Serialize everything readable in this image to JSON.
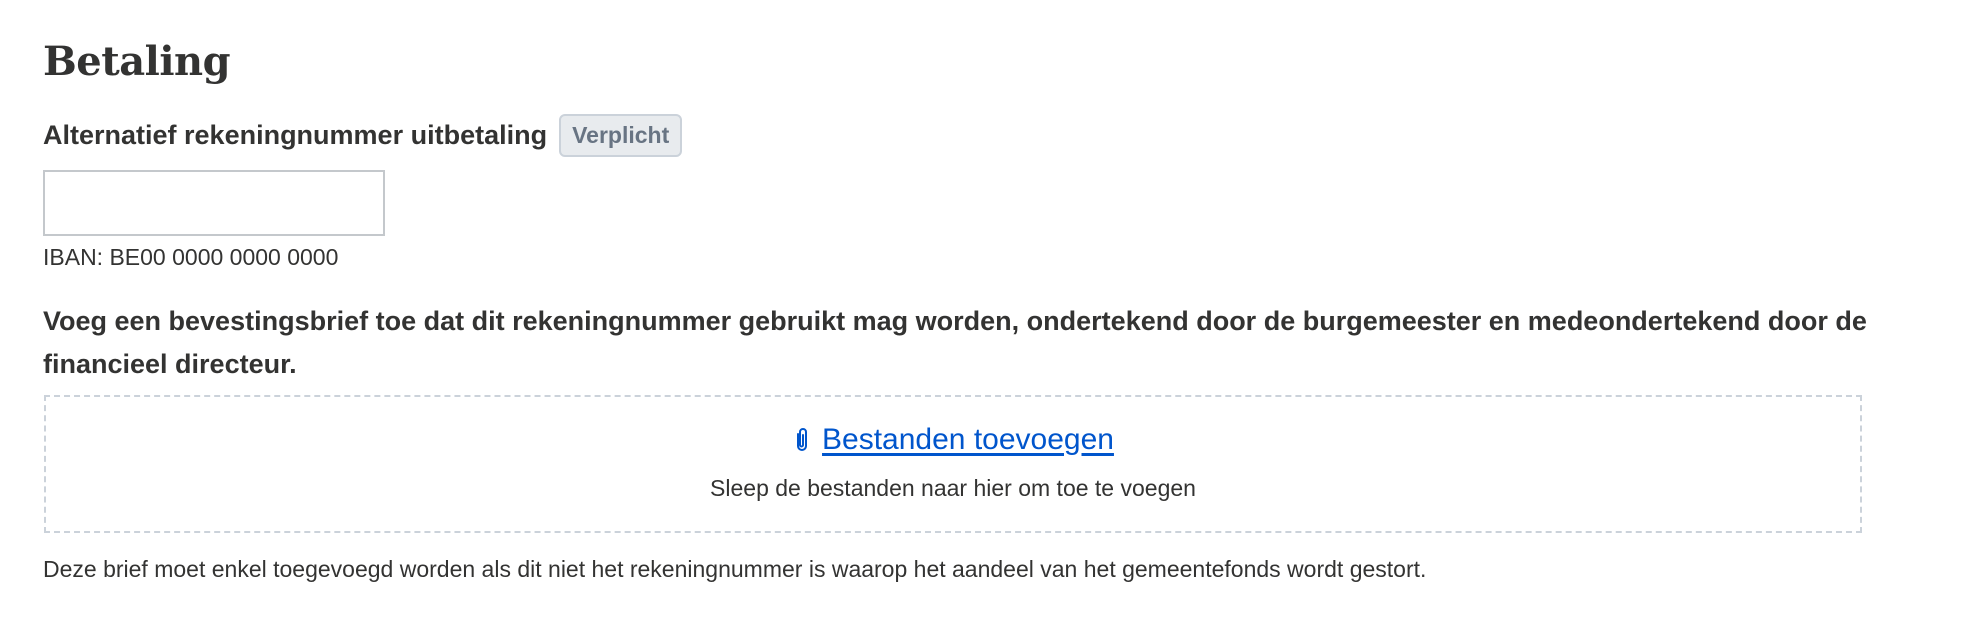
{
  "section": {
    "title": "Betaling"
  },
  "field": {
    "label": "Alternatief rekeningnummer uitbetaling",
    "required_badge": "Verplicht",
    "value": "",
    "helper": "IBAN: BE00 0000 0000 0000"
  },
  "upload": {
    "question": "Voeg een bevestingsbrief toe dat dit rekeningnummer gebruikt mag worden, ondertekend door de burgemeester en medeondertekend door de financieel directeur.",
    "link_label": "Bestanden toevoegen",
    "link_icon": "paperclip-icon",
    "hint": "Sleep de bestanden naar hier om toe te voegen",
    "footnote": "Deze brief moet enkel toegevoegd worden als dit niet het rekeningnummer is waarop het aandeel van het gemeentefonds wordt gestort."
  },
  "colors": {
    "text": "#333332",
    "link": "#0055cc",
    "badge_bg": "#e8ebee",
    "badge_text": "#687483",
    "border": "#cbd2da"
  }
}
